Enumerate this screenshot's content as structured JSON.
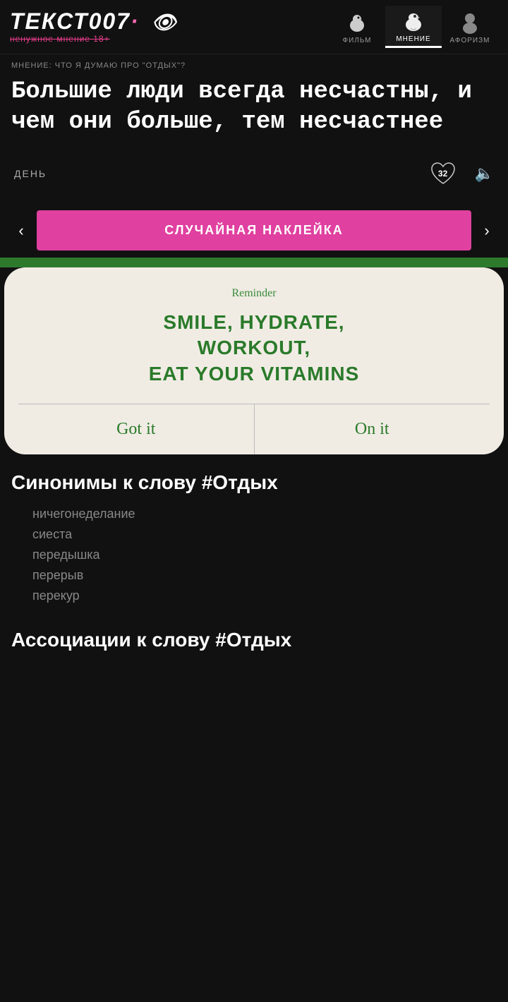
{
  "header": {
    "logo": "ТЕКСТ007",
    "logo_dot": "·",
    "subtitle": "ненужное мнение 18+",
    "nav": [
      {
        "label": "ФИЛЬМ",
        "active": false
      },
      {
        "label": "МНЕНИЕ",
        "active": true
      },
      {
        "label": "АФОРИЗМ",
        "active": false
      }
    ]
  },
  "breadcrumb": "МНЕНИЕ: ЧТО Я ДУМАЮ ПРО \"ОТДЫХ\"?",
  "quote": "Большие люди всегда несчастны, и чем они больше, тем несчастнее",
  "day_label": "ДЕНЬ",
  "heart_count": "32",
  "sticker_btn": "СЛУЧАЙНАЯ НАКЛЕЙКА",
  "reminder": {
    "label": "Reminder",
    "body": "SMILE, HYDRATE,\nWORKOUT,\nEAT YOUR VITAMINS",
    "btn_left": "Got it",
    "btn_right": "On it"
  },
  "synonyms": {
    "title": "Синонимы к слову #Отдых",
    "items": [
      "ничегонеделание",
      "сиеста",
      "передышка",
      "перерыв",
      "перекур"
    ]
  },
  "associations": {
    "title": "Ассоциации к слову #Отдых"
  }
}
